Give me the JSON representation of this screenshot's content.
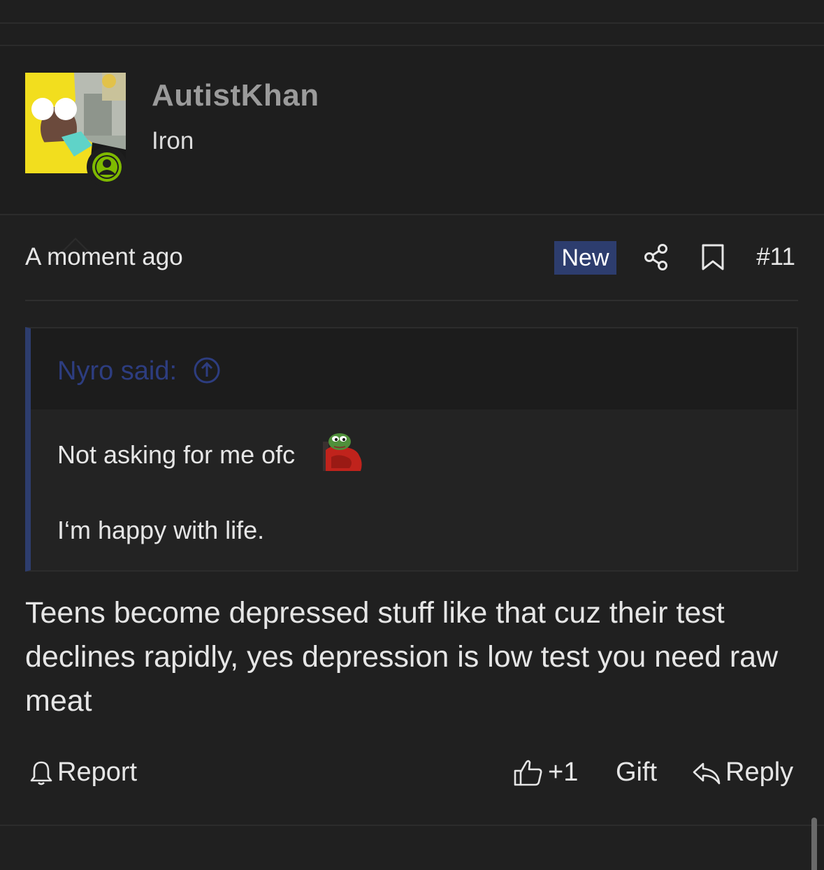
{
  "post": {
    "author": {
      "username": "AutistKhan",
      "title": "Iron",
      "avatar_icon": "user-avatar-photo",
      "online_icon": "user-online-icon"
    },
    "meta": {
      "time": "A moment ago",
      "new_badge": "New",
      "share_icon": "share-icon",
      "bookmark_icon": "bookmark-icon",
      "number": "#11"
    },
    "quote": {
      "author_label": "Nyro said:",
      "jump_icon": "arrow-up-circle-icon",
      "line1": "Not asking for me ofc",
      "emoji": "pepe-blanket-emoji",
      "line2": "I‘m happy with life."
    },
    "message": "Teens become depressed stuff like that cuz their test declines rapidly, yes depression is low test you need raw meat",
    "actions": {
      "report": "Report",
      "like": "+1",
      "gift": "Gift",
      "reply": "Reply"
    }
  },
  "colors": {
    "background": "#202020",
    "accent": "#2d3d6e",
    "online": "#7fba00",
    "username": "#9b9b9b"
  }
}
